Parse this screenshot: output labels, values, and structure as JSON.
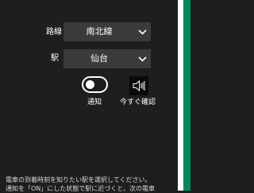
{
  "form": {
    "line_label": "路線",
    "line_value": "南北線",
    "station_label": "駅",
    "station_value": "仙台"
  },
  "controls": {
    "notify_label": "通知",
    "notify_on": false,
    "check_now_label": "今すぐ確認"
  },
  "description": {
    "line1": "電車の到着時刻を知りたい駅を選択してください。",
    "line2": "通知を「ON」にした状態で駅に近づくと、次の電車"
  },
  "colors": {
    "background": "#1e1e1e",
    "select_background": "#3b3b3b",
    "accent": "#008a5a"
  }
}
